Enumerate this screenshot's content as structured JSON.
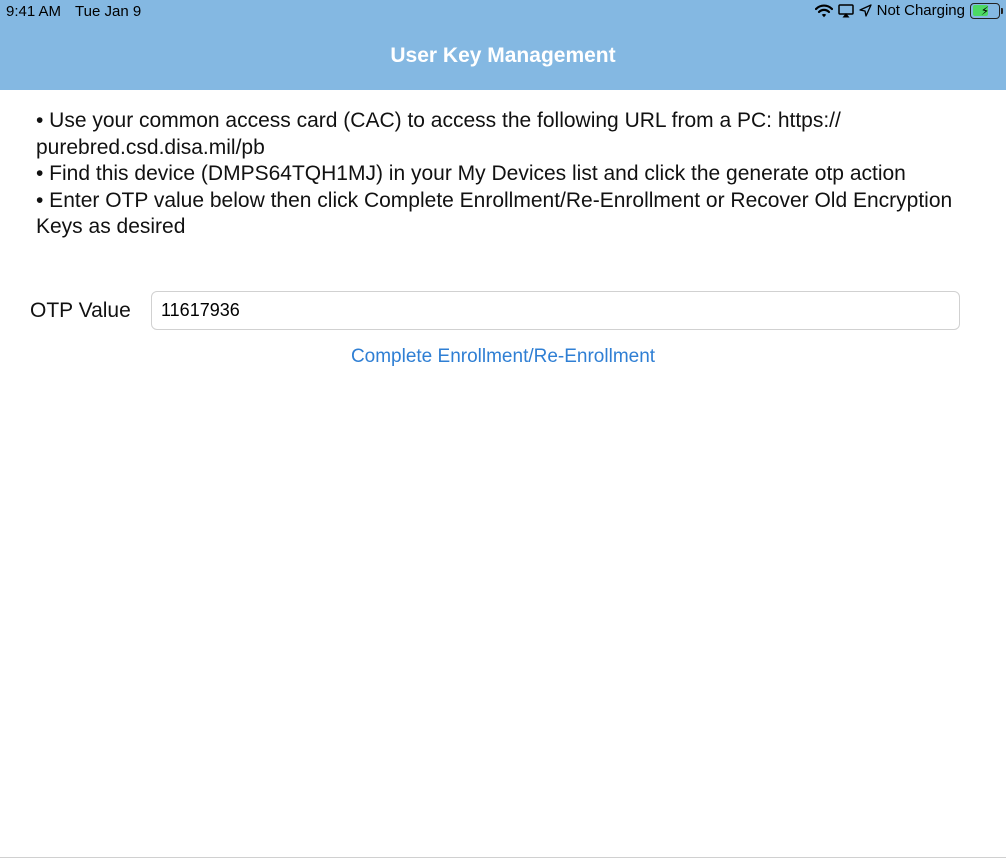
{
  "status_bar": {
    "time": "9:41 AM",
    "date": "Tue Jan 9",
    "charging_text": "Not Charging",
    "battery_level": 0.6,
    "icons": [
      "wifi-icon",
      "airplay-icon",
      "location-icon",
      "battery-icon"
    ]
  },
  "nav": {
    "title": "User Key Management"
  },
  "instructions": {
    "line1": "• Use your common access card (CAC) to access the following URL from a PC: https:// purebred.csd.disa.mil/pb",
    "line2": "• Find this device (DMPS64TQH1MJ) in your My Devices list and click the generate otp action",
    "line3": "• Enter OTP value below then click Complete Enrollment/Re-Enrollment or Recover Old Encryption Keys as desired"
  },
  "otp": {
    "label": "OTP Value",
    "value": "11617936"
  },
  "actions": {
    "enroll_label": "Complete Enrollment/Re-Enrollment"
  },
  "colors": {
    "nav_background": "#84b8e2",
    "nav_title": "#ffffff",
    "link": "#2f7fd4",
    "battery_fill": "#4cd964"
  }
}
